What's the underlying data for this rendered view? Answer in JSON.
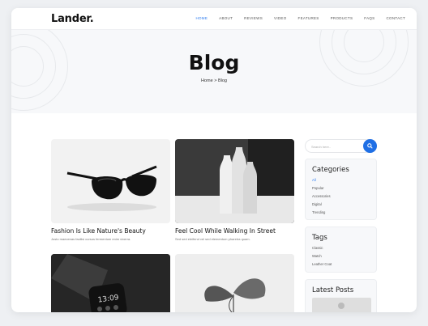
{
  "header": {
    "logo": "Lander.",
    "nav": [
      "HOME",
      "ABOUT",
      "REVIEWS",
      "VIDEO",
      "FEATURES",
      "PRODUCTS",
      "FAQS",
      "CONTACT"
    ],
    "active_index": 0
  },
  "hero": {
    "title": "Blog",
    "breadcrumb_home": "Home",
    "breadcrumb_sep": ">",
    "breadcrumb_current": "Blog"
  },
  "posts": [
    {
      "title": "Fashion Is Like Nature's Beauty",
      "excerpt": "Justo maecenas facilisi cursus fermentum enim viverra.",
      "image": "sunglasses-photo"
    },
    {
      "title": "Feel Cool While Walking In Street",
      "excerpt": "Sed sed eleifend vel sed elementum pharetra quam.",
      "image": "vases-photo"
    },
    {
      "title": "",
      "excerpt": "",
      "image": "smartwatch-photo"
    },
    {
      "title": "",
      "excerpt": "",
      "image": "leaf-plant-photo"
    }
  ],
  "sidebar": {
    "search_placeholder": "Search here..",
    "categories_title": "Categories",
    "categories": [
      "All",
      "Popular",
      "Accessories",
      "Digital",
      "Trending"
    ],
    "categories_active": 0,
    "tags_title": "Tags",
    "tags": [
      "Classic",
      "Watch",
      "Leather Coat"
    ],
    "latest_title": "Latest Posts"
  },
  "colors": {
    "accent": "#2b7bf0",
    "button": "#1f6fe5"
  }
}
